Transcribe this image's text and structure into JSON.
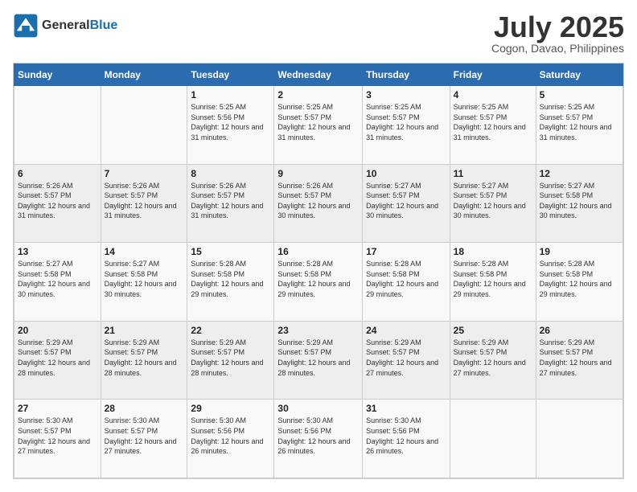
{
  "header": {
    "logo_line1": "General",
    "logo_line2": "Blue",
    "month": "July 2025",
    "location": "Cogon, Davao, Philippines"
  },
  "weekdays": [
    "Sunday",
    "Monday",
    "Tuesday",
    "Wednesday",
    "Thursday",
    "Friday",
    "Saturday"
  ],
  "weeks": [
    [
      {
        "day": "",
        "detail": ""
      },
      {
        "day": "",
        "detail": ""
      },
      {
        "day": "1",
        "detail": "Sunrise: 5:25 AM\nSunset: 5:56 PM\nDaylight: 12 hours and 31 minutes."
      },
      {
        "day": "2",
        "detail": "Sunrise: 5:25 AM\nSunset: 5:57 PM\nDaylight: 12 hours and 31 minutes."
      },
      {
        "day": "3",
        "detail": "Sunrise: 5:25 AM\nSunset: 5:57 PM\nDaylight: 12 hours and 31 minutes."
      },
      {
        "day": "4",
        "detail": "Sunrise: 5:25 AM\nSunset: 5:57 PM\nDaylight: 12 hours and 31 minutes."
      },
      {
        "day": "5",
        "detail": "Sunrise: 5:25 AM\nSunset: 5:57 PM\nDaylight: 12 hours and 31 minutes."
      }
    ],
    [
      {
        "day": "6",
        "detail": "Sunrise: 5:26 AM\nSunset: 5:57 PM\nDaylight: 12 hours and 31 minutes."
      },
      {
        "day": "7",
        "detail": "Sunrise: 5:26 AM\nSunset: 5:57 PM\nDaylight: 12 hours and 31 minutes."
      },
      {
        "day": "8",
        "detail": "Sunrise: 5:26 AM\nSunset: 5:57 PM\nDaylight: 12 hours and 31 minutes."
      },
      {
        "day": "9",
        "detail": "Sunrise: 5:26 AM\nSunset: 5:57 PM\nDaylight: 12 hours and 30 minutes."
      },
      {
        "day": "10",
        "detail": "Sunrise: 5:27 AM\nSunset: 5:57 PM\nDaylight: 12 hours and 30 minutes."
      },
      {
        "day": "11",
        "detail": "Sunrise: 5:27 AM\nSunset: 5:57 PM\nDaylight: 12 hours and 30 minutes."
      },
      {
        "day": "12",
        "detail": "Sunrise: 5:27 AM\nSunset: 5:58 PM\nDaylight: 12 hours and 30 minutes."
      }
    ],
    [
      {
        "day": "13",
        "detail": "Sunrise: 5:27 AM\nSunset: 5:58 PM\nDaylight: 12 hours and 30 minutes."
      },
      {
        "day": "14",
        "detail": "Sunrise: 5:27 AM\nSunset: 5:58 PM\nDaylight: 12 hours and 30 minutes."
      },
      {
        "day": "15",
        "detail": "Sunrise: 5:28 AM\nSunset: 5:58 PM\nDaylight: 12 hours and 29 minutes."
      },
      {
        "day": "16",
        "detail": "Sunrise: 5:28 AM\nSunset: 5:58 PM\nDaylight: 12 hours and 29 minutes."
      },
      {
        "day": "17",
        "detail": "Sunrise: 5:28 AM\nSunset: 5:58 PM\nDaylight: 12 hours and 29 minutes."
      },
      {
        "day": "18",
        "detail": "Sunrise: 5:28 AM\nSunset: 5:58 PM\nDaylight: 12 hours and 29 minutes."
      },
      {
        "day": "19",
        "detail": "Sunrise: 5:28 AM\nSunset: 5:58 PM\nDaylight: 12 hours and 29 minutes."
      }
    ],
    [
      {
        "day": "20",
        "detail": "Sunrise: 5:29 AM\nSunset: 5:57 PM\nDaylight: 12 hours and 28 minutes."
      },
      {
        "day": "21",
        "detail": "Sunrise: 5:29 AM\nSunset: 5:57 PM\nDaylight: 12 hours and 28 minutes."
      },
      {
        "day": "22",
        "detail": "Sunrise: 5:29 AM\nSunset: 5:57 PM\nDaylight: 12 hours and 28 minutes."
      },
      {
        "day": "23",
        "detail": "Sunrise: 5:29 AM\nSunset: 5:57 PM\nDaylight: 12 hours and 28 minutes."
      },
      {
        "day": "24",
        "detail": "Sunrise: 5:29 AM\nSunset: 5:57 PM\nDaylight: 12 hours and 27 minutes."
      },
      {
        "day": "25",
        "detail": "Sunrise: 5:29 AM\nSunset: 5:57 PM\nDaylight: 12 hours and 27 minutes."
      },
      {
        "day": "26",
        "detail": "Sunrise: 5:29 AM\nSunset: 5:57 PM\nDaylight: 12 hours and 27 minutes."
      }
    ],
    [
      {
        "day": "27",
        "detail": "Sunrise: 5:30 AM\nSunset: 5:57 PM\nDaylight: 12 hours and 27 minutes."
      },
      {
        "day": "28",
        "detail": "Sunrise: 5:30 AM\nSunset: 5:57 PM\nDaylight: 12 hours and 27 minutes."
      },
      {
        "day": "29",
        "detail": "Sunrise: 5:30 AM\nSunset: 5:56 PM\nDaylight: 12 hours and 26 minutes."
      },
      {
        "day": "30",
        "detail": "Sunrise: 5:30 AM\nSunset: 5:56 PM\nDaylight: 12 hours and 26 minutes."
      },
      {
        "day": "31",
        "detail": "Sunrise: 5:30 AM\nSunset: 5:56 PM\nDaylight: 12 hours and 26 minutes."
      },
      {
        "day": "",
        "detail": ""
      },
      {
        "day": "",
        "detail": ""
      }
    ]
  ]
}
